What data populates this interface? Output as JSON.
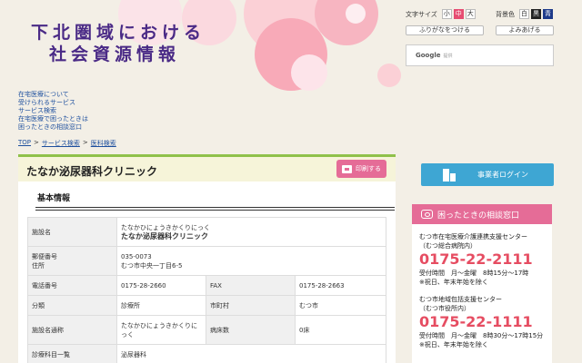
{
  "header": {
    "title_line1": "下北圏域における",
    "title_line2": "社会資源情報",
    "font_size_label": "文字サイズ",
    "font_sizes": [
      "小",
      "中",
      "大"
    ],
    "bg_color_label": "背景色",
    "bg_colors": [
      "白",
      "黒",
      "青"
    ],
    "furigana_button": "ふりがなをつける",
    "read_aloud_button": "よみあげる",
    "search_brand": "Google",
    "search_suffix": "提供"
  },
  "nav": {
    "links": [
      "在宅医療について",
      "受けられるサービス",
      "サービス検索",
      "在宅医療で困ったときは",
      "困ったときの相談窓口"
    ]
  },
  "breadcrumb": {
    "items": [
      "TOP",
      "サービス検索",
      "医科検索"
    ],
    "separator": ">"
  },
  "main": {
    "clinic_name": "たなか泌尿器科クリニック",
    "print_button": "印刷する",
    "section_title": "基本情報",
    "rows": {
      "facility_label": "施設名",
      "facility_kana": "たなかひにょうきかくりにっく",
      "facility_name": "たなか泌尿器科クリニック",
      "postal_label": "郵便番号",
      "address_label": "住所",
      "postal_value": "035-0073",
      "address_value": "むつ市中央一丁目6-5",
      "tel_label": "電話番号",
      "tel_value": "0175-28-2660",
      "fax_label": "FAX",
      "fax_value": "0175-28-2663",
      "category_label": "分類",
      "category_value": "診療所",
      "city_label": "市町村",
      "city_value": "むつ市",
      "alias_label": "施設名通称",
      "alias_value": "たなかひにょうきかくりにっく",
      "beds_label": "病床数",
      "beds_value": "0床",
      "departments_label": "診療科目一覧",
      "departments_value": "泌尿器科"
    }
  },
  "sidebar": {
    "login_button": "事業者ログイン",
    "consult_title": "困ったときの相談窓口",
    "centers": [
      {
        "name_line1": "むつ市在宅医療介護連携支援センター",
        "name_line2": "（むつ総合病院内）",
        "tel": "0175-22-2111",
        "hours": "受付時間　月～金曜　8時15分～17時",
        "note": "※祝日、年末年始を除く"
      },
      {
        "name_line1": "むつ市地域包括支援センター",
        "name_line2": "（むつ市役所内）",
        "tel": "0175-22-1111",
        "hours": "受付時間　月～金曜　8時30分～17時15分",
        "note": "※祝日、年末年始を除く"
      }
    ]
  },
  "colors": {
    "title_purple": "#4a2a86",
    "accent_pink": "#e56c97",
    "link_blue": "#1d4f9e",
    "login_blue": "#3ea6d3",
    "tel_red": "#e64d62",
    "header_green": "#8fc14a"
  }
}
